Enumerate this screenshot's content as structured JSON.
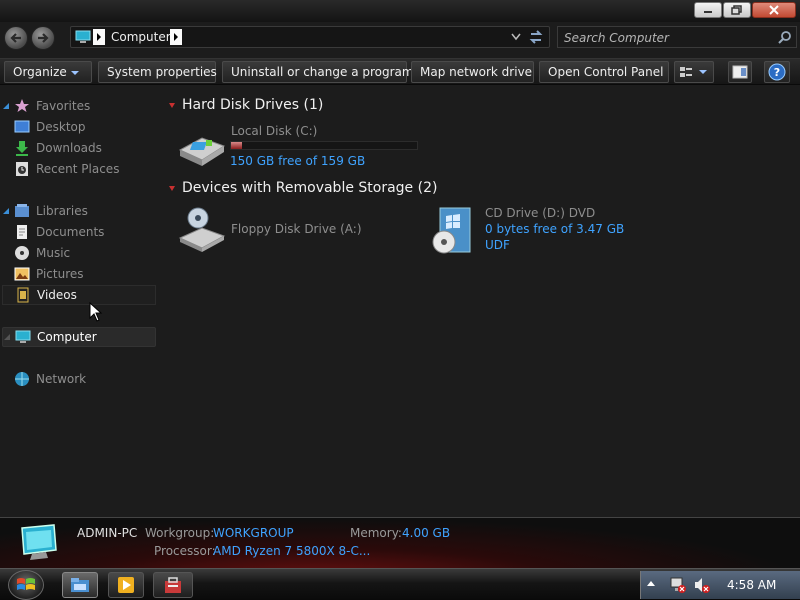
{
  "window": {
    "buttons": {
      "minimize": "minimize",
      "maximize": "maximize",
      "close": "close"
    }
  },
  "address": {
    "crumb": "Computer"
  },
  "search": {
    "placeholder": "Search Computer"
  },
  "toolbar": {
    "organize": "Organize",
    "system_properties": "System properties",
    "uninstall": "Uninstall or change a program",
    "map_drive": "Map network drive",
    "control_panel": "Open Control Panel"
  },
  "sidebar": {
    "favorites": "Favorites",
    "desktop": "Desktop",
    "downloads": "Downloads",
    "recent": "Recent Places",
    "libraries": "Libraries",
    "documents": "Documents",
    "music": "Music",
    "pictures": "Pictures",
    "videos": "Videos",
    "computer": "Computer",
    "network": "Network"
  },
  "groups": {
    "hard_disks": "Hard Disk Drives (1)",
    "removable": "Devices with Removable Storage (2)"
  },
  "drives": {
    "c": {
      "name": "Local Disk (C:)",
      "free": "150 GB free of 159 GB",
      "used_fraction": 0.057
    },
    "a": {
      "name": "Floppy Disk Drive (A:)"
    },
    "d": {
      "name": "CD Drive (D:) DVD",
      "free": "0 bytes free of 3.47 GB",
      "fs": "UDF"
    }
  },
  "details": {
    "pc_name": "ADMIN-PC",
    "workgroup_label": "Workgroup:",
    "workgroup": "WORKGROUP",
    "memory_label": "Memory:",
    "memory": "4.00 GB",
    "processor_label": "Processor:",
    "processor": "AMD Ryzen 7 5800X 8-C..."
  },
  "taskbar": {
    "clock": "4:58 AM"
  },
  "colors": {
    "accent_blue": "#3fa3ff",
    "group_triangle": "#c83030",
    "window_bg": "#1c1c1c"
  }
}
